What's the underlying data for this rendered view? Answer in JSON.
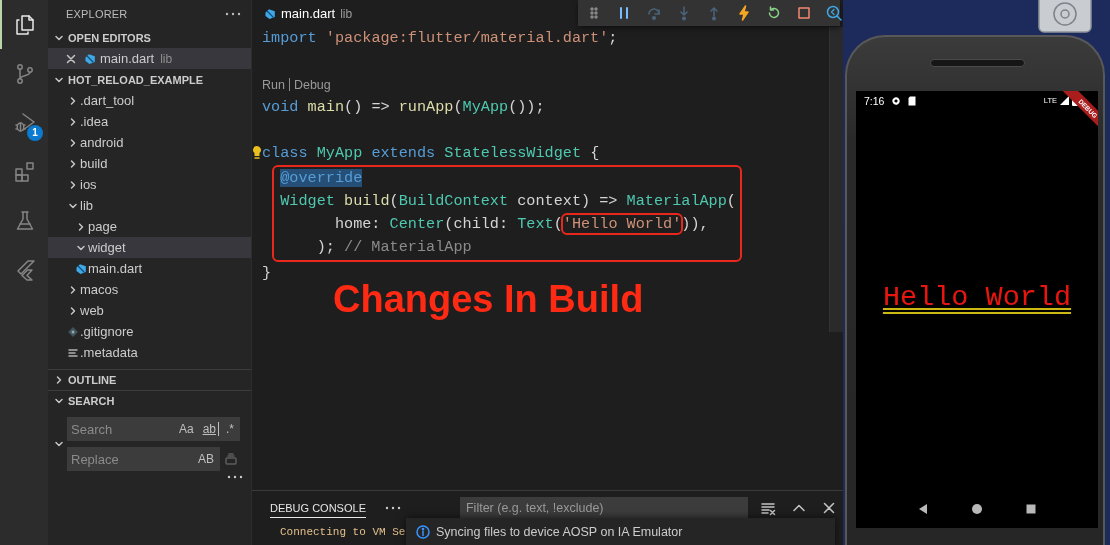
{
  "activity_bar": [
    {
      "kind": "explorer",
      "selected": true
    },
    {
      "kind": "source-control",
      "selected": false
    },
    {
      "kind": "run-debug",
      "selected": false,
      "badge": "1"
    },
    {
      "kind": "extensions",
      "selected": false
    },
    {
      "kind": "testing",
      "selected": false
    },
    {
      "kind": "flutter",
      "selected": false
    }
  ],
  "sidebar": {
    "title": "EXPLORER",
    "sections": [
      {
        "kind": "open-editors",
        "title": "OPEN EDITORS",
        "expanded": true,
        "items": [
          {
            "name": "main.dart",
            "detail": "lib",
            "kind": "dart",
            "selected": true
          }
        ]
      },
      {
        "kind": "tree",
        "title": "HOT_RELOAD_EXAMPLE",
        "expanded": true,
        "items": [
          {
            "name": ".dart_tool",
            "kind": "folder",
            "expanded": false,
            "selected": false
          },
          {
            "name": ".idea",
            "kind": "folder",
            "expanded": false,
            "selected": false
          },
          {
            "name": "android",
            "kind": "folder",
            "expanded": false,
            "selected": false
          },
          {
            "name": "build",
            "kind": "folder",
            "expanded": false,
            "selected": false
          },
          {
            "name": "ios",
            "kind": "folder",
            "expanded": false,
            "selected": false
          },
          {
            "name": "lib",
            "kind": "folder",
            "expanded": true,
            "selected": false,
            "children": [
              {
                "name": "page",
                "kind": "folder",
                "expanded": false,
                "selected": false
              },
              {
                "name": "widget",
                "kind": "folder",
                "expanded": true,
                "selected": true
              },
              {
                "name": "main.dart",
                "kind": "dart",
                "selected": false
              }
            ]
          },
          {
            "name": "macos",
            "kind": "folder",
            "expanded": false,
            "selected": false
          },
          {
            "name": "web",
            "kind": "folder",
            "expanded": false,
            "selected": false
          },
          {
            "name": ".gitignore",
            "kind": "git",
            "selected": false
          },
          {
            "name": ".metadata",
            "kind": "text",
            "selected": false
          }
        ]
      },
      {
        "kind": "outline",
        "title": "OUTLINE",
        "expanded": false
      },
      {
        "kind": "search",
        "title": "SEARCH",
        "expanded": true,
        "search": {
          "placeholder": "Search",
          "options": [
            {
              "label": "Aa",
              "kind": "toggle"
            },
            {
              "label": "ab",
              "kind": "word-toggle"
            },
            {
              "label": ".*",
              "kind": "toggle"
            }
          ]
        },
        "replace": {
          "placeholder": "Replace",
          "options": [
            {
              "label": "AB",
              "kind": "toggle"
            }
          ]
        }
      }
    ]
  },
  "editor": {
    "tab": {
      "name": "main.dart",
      "detail": "lib"
    },
    "debug_toolbar": [
      {
        "kind": "grip"
      },
      {
        "kind": "pause",
        "disabled": false
      },
      {
        "kind": "step-over",
        "disabled": true
      },
      {
        "kind": "step-into",
        "disabled": true
      },
      {
        "kind": "step-out",
        "disabled": true
      },
      {
        "kind": "hot-reload",
        "disabled": false
      },
      {
        "kind": "restart",
        "disabled": false
      },
      {
        "kind": "stop",
        "disabled": false
      },
      {
        "kind": "inspector",
        "disabled": false
      }
    ],
    "lines": [
      {
        "kind": "code",
        "tokens": [
          {
            "text": "import ",
            "kind": "keyword"
          },
          {
            "text": "'package:flutter/material.dart'",
            "kind": "string"
          },
          {
            "text": ";"
          }
        ]
      },
      {
        "kind": "blank"
      },
      {
        "kind": "codelens",
        "links": [
          "Run",
          "Debug"
        ]
      },
      {
        "kind": "code",
        "tokens": [
          {
            "text": "void ",
            "kind": "keyword"
          },
          {
            "text": "main",
            "kind": "function"
          },
          {
            "text": "() => "
          },
          {
            "text": "runApp",
            "kind": "function"
          },
          {
            "text": "("
          },
          {
            "text": "MyApp",
            "kind": "type"
          },
          {
            "text": "());"
          }
        ]
      },
      {
        "kind": "blank"
      },
      {
        "kind": "code",
        "lightbulb": true,
        "tokens": [
          {
            "text": "class ",
            "kind": "keyword"
          },
          {
            "text": "MyApp ",
            "kind": "type"
          },
          {
            "text": "extends ",
            "kind": "keyword"
          },
          {
            "text": "StatelessWidget",
            "kind": "type"
          },
          {
            "text": " {"
          }
        ]
      },
      {
        "kind": "code",
        "annotated": true,
        "tokens": [
          {
            "text": "  @override",
            "kind": "keyword",
            "selected": true
          }
        ]
      },
      {
        "kind": "code",
        "annotated": true,
        "tokens": [
          {
            "text": "  Widget ",
            "kind": "type"
          },
          {
            "text": "build",
            "kind": "function"
          },
          {
            "text": "("
          },
          {
            "text": "BuildContext",
            "kind": "type"
          },
          {
            "text": " context) => "
          },
          {
            "text": "MaterialApp",
            "kind": "type"
          },
          {
            "text": "("
          }
        ]
      },
      {
        "kind": "code",
        "annotated": true,
        "tokens": [
          {
            "text": "        home: "
          },
          {
            "text": "Center",
            "kind": "type"
          },
          {
            "text": "(child: "
          },
          {
            "text": "Text",
            "kind": "type"
          },
          {
            "text": "("
          },
          {
            "text": "'Hello World'",
            "kind": "string",
            "boxed": true
          },
          {
            "text": ")),"
          }
        ]
      },
      {
        "kind": "code",
        "annotated": true,
        "tokens": [
          {
            "text": "      ); "
          },
          {
            "text": "// MaterialApp",
            "kind": "comment"
          }
        ]
      },
      {
        "kind": "code",
        "tokens": [
          {
            "text": "}"
          }
        ]
      }
    ],
    "annotation": "Changes In Build"
  },
  "panel": {
    "tabs": [
      {
        "label": "DEBUG CONSOLE",
        "selected": true
      }
    ],
    "filter": {
      "placeholder": "Filter (e.g. text, !exclude)"
    },
    "output": [
      {
        "text": "Connecting to VM Se",
        "kind": "info"
      }
    ],
    "notification": {
      "kind": "info",
      "message": "Syncing files to device AOSP on IA Emulator"
    }
  },
  "emulator": {
    "status_bar": {
      "time": "7:16",
      "network": "LTE"
    },
    "debug_banner": "DEBUG",
    "app_text": "Hello World"
  }
}
